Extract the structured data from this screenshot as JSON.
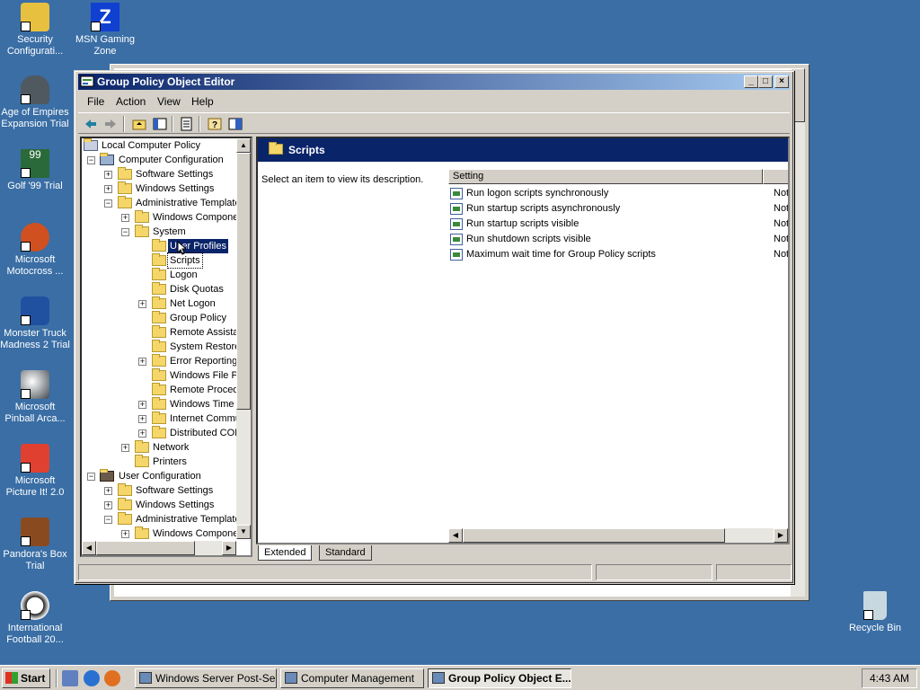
{
  "desktop": {
    "icons": [
      {
        "label": "Security Configurati...",
        "icon": "security-config-icon"
      },
      {
        "label": "MSN Gaming Zone",
        "icon": "msn-gaming-zone-icon"
      },
      {
        "label": "Age of Empires Expansion Trial",
        "icon": "age-of-empires-icon"
      },
      {
        "label": "Golf '99 Trial",
        "icon": "golf-99-icon"
      },
      {
        "label": "Microsoft Motocross ...",
        "icon": "motocross-icon"
      },
      {
        "label": "Monster Truck Madness 2 Trial",
        "icon": "monster-truck-icon"
      },
      {
        "label": "Microsoft Pinball Arca...",
        "icon": "pinball-icon"
      },
      {
        "label": "Microsoft Picture It! 2.0",
        "icon": "picture-it-icon"
      },
      {
        "label": "Pandora's Box Trial",
        "icon": "pandoras-box-icon"
      },
      {
        "label": "International Football 20...",
        "icon": "football-icon"
      },
      {
        "label": "Recycle Bin",
        "icon": "recycle-bin-icon"
      }
    ]
  },
  "window": {
    "title": "Group Policy Object Editor",
    "controls": {
      "minimize": "_",
      "maximize": "□",
      "close": "×"
    },
    "menu": [
      "File",
      "Action",
      "View",
      "Help"
    ],
    "toolbar": [
      "back-icon",
      "forward-icon",
      "up-folder-icon",
      "show-hide-tree-icon",
      "export-list-icon",
      "help-icon",
      "console-tree-icon"
    ]
  },
  "tree": {
    "items": [
      "Local Computer Policy",
      "Computer Configuration",
      "Software Settings",
      "Windows Settings",
      "Administrative Template",
      "Windows Componer",
      "System",
      "User Profiles",
      "Scripts",
      "Logon",
      "Disk Quotas",
      "Net Logon",
      "Group Policy",
      "Remote Assista",
      "System Restore",
      "Error Reporting",
      "Windows File Pr",
      "Remote Procedu",
      "Windows Time S",
      "Internet Commu",
      "Distributed COM",
      "Network",
      "Printers",
      "User Configuration",
      "Software Settings",
      "Windows Settings",
      "Administrative Template",
      "Windows Componer"
    ],
    "selected": "User Profiles"
  },
  "details": {
    "header": "Scripts",
    "description": "Select an item to view its description.",
    "column_setting": "Setting",
    "rows": [
      {
        "setting": "Run logon scripts synchronously",
        "state": "Not"
      },
      {
        "setting": "Run startup scripts asynchronously",
        "state": "Not"
      },
      {
        "setting": "Run startup scripts visible",
        "state": "Not"
      },
      {
        "setting": "Run shutdown scripts visible",
        "state": "Not"
      },
      {
        "setting": "Maximum wait time for Group Policy scripts",
        "state": "Not"
      }
    ],
    "tabs": [
      "Extended",
      "Standard"
    ],
    "active_tab": "Extended"
  },
  "taskbar": {
    "start_label": "Start",
    "tasks": [
      "Windows Server Post-Se...",
      "Computer Management",
      "Group Policy Object E..."
    ],
    "active_task": "Group Policy Object E...",
    "clock": "4:43 AM"
  },
  "colors": {
    "desktop": "#3a6ea5",
    "titlebar": "#0a246a",
    "chrome": "#d4d0c8"
  }
}
